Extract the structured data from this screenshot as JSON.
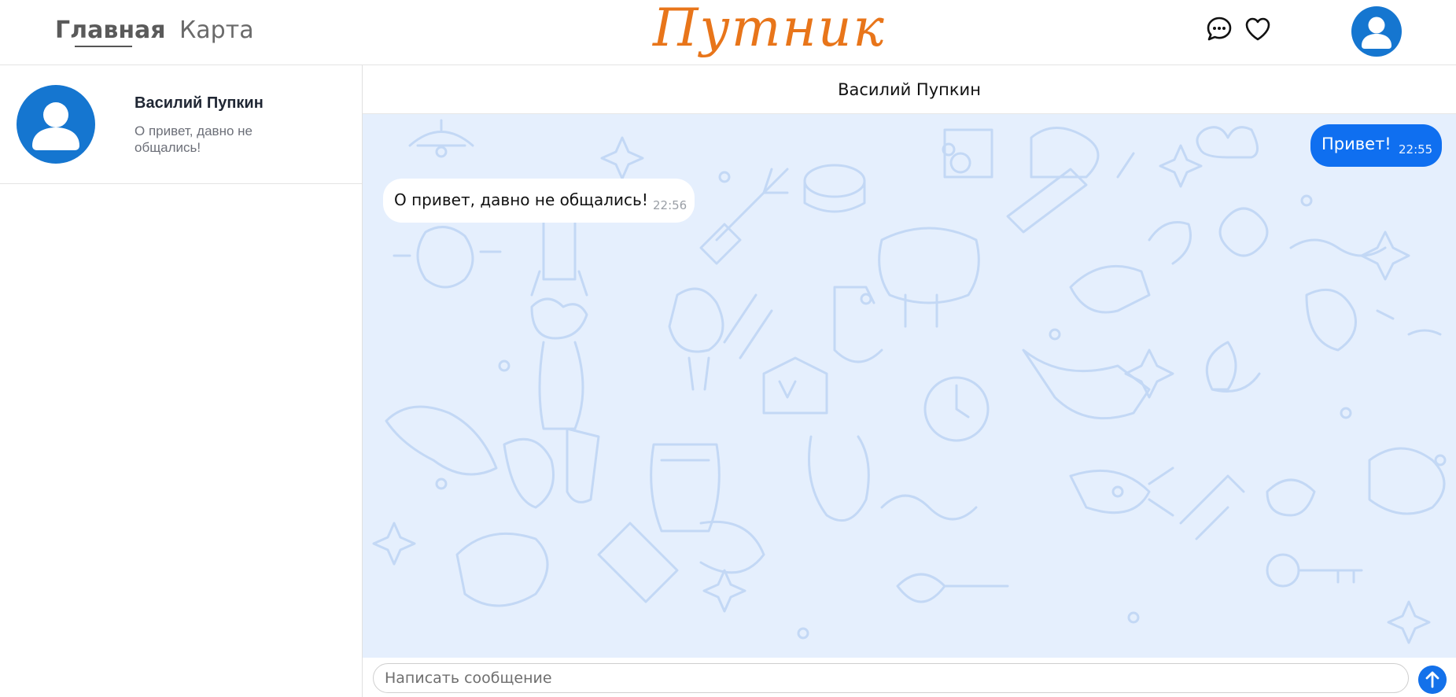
{
  "header": {
    "nav": {
      "home": "Главная",
      "map": "Карта"
    },
    "logo": "Путник",
    "icons": {
      "chat": "chat-bubble-icon",
      "favorites": "heart-icon",
      "profile": "user-avatar-icon"
    }
  },
  "sidebar": {
    "contacts": [
      {
        "name": "Василий Пупкин",
        "preview": "О привет, давно не общались!"
      }
    ]
  },
  "chat": {
    "title": "Василий Пупкин",
    "messages": [
      {
        "direction": "outgoing",
        "text": "Привет!",
        "time": "22:55"
      },
      {
        "direction": "incoming",
        "text": "О привет, давно не общались!",
        "time": "22:56"
      }
    ],
    "composer": {
      "placeholder": "Написать сообщение",
      "value": ""
    }
  },
  "colors": {
    "accent": "#0f6ff0",
    "logo": "#e8751a",
    "avatar": "#1576d0",
    "chat_bg": "#e5effd"
  }
}
